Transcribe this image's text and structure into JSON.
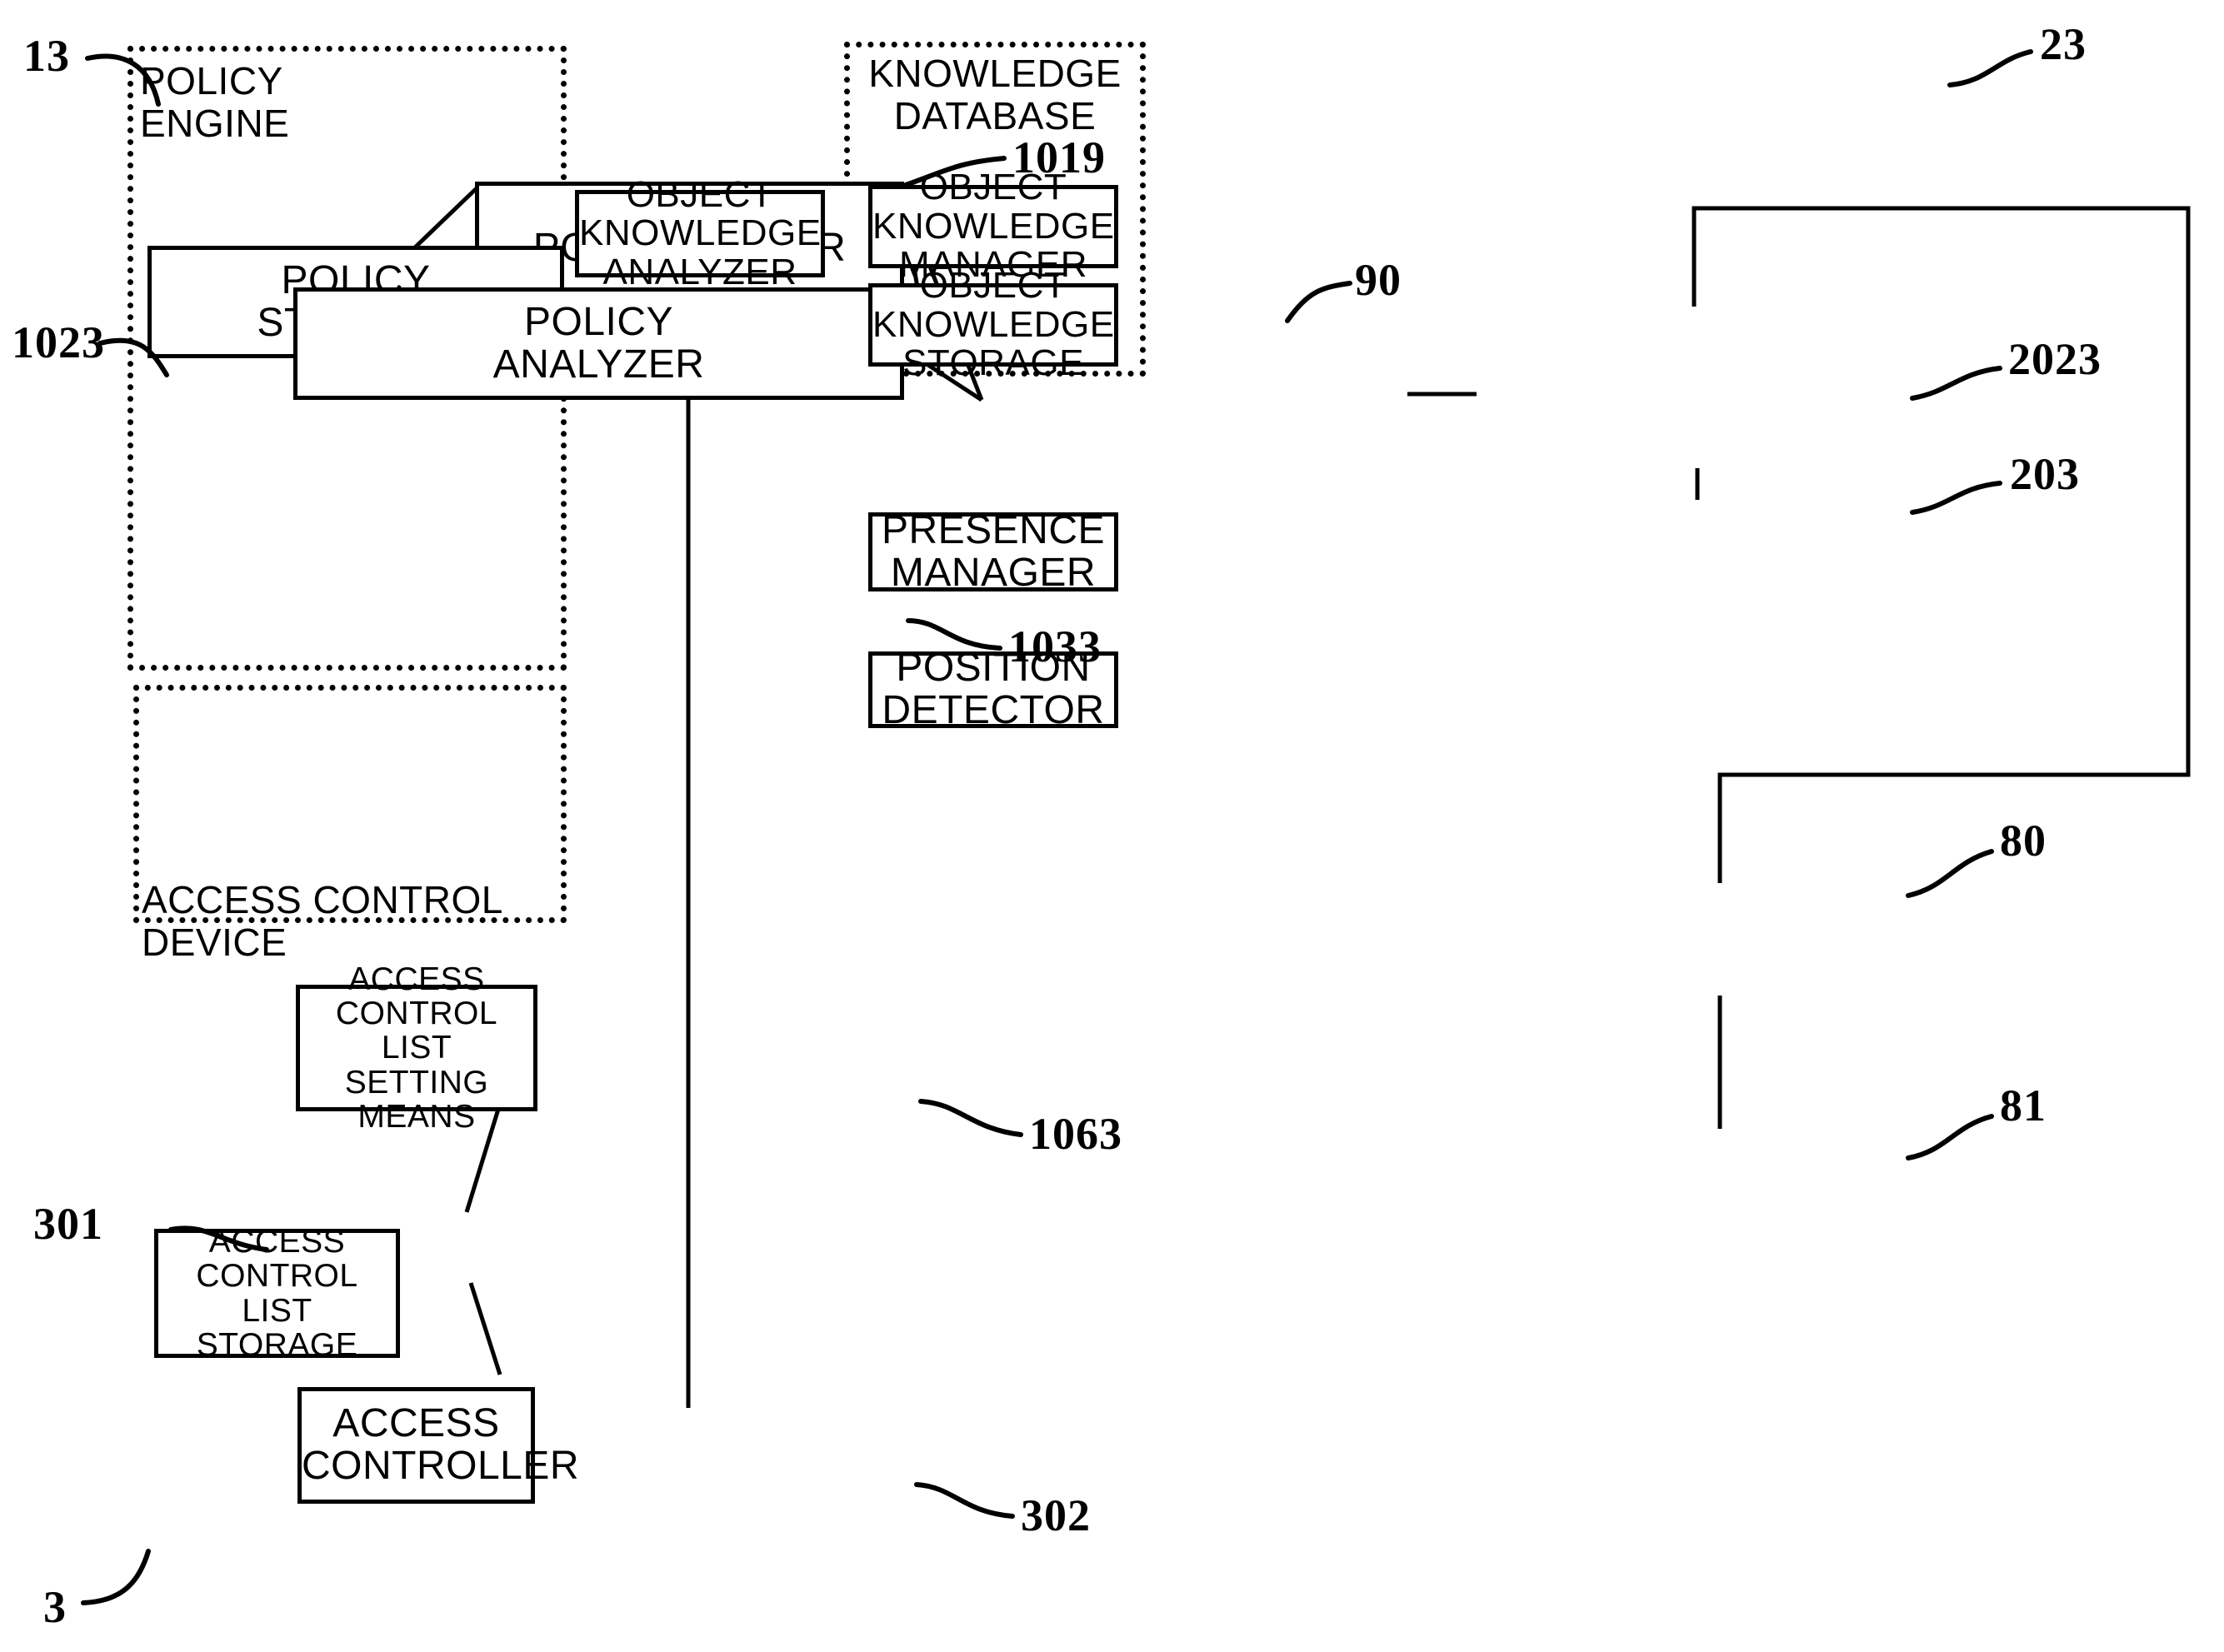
{
  "figure": {
    "kind": "patent-block-diagram",
    "background_color": "#ffffff",
    "line_color": "#000000"
  },
  "groups": [
    {
      "id": "policy-engine",
      "title": "POLICY ENGINE",
      "ref": "13"
    },
    {
      "id": "access-control-device",
      "title": "ACCESS CONTROL DEVICE",
      "ref": "3"
    },
    {
      "id": "knowledge-database",
      "title": "KNOWLEDGE\nDATABASE",
      "ref": "23"
    }
  ],
  "blocks": [
    {
      "id": "policy-editor",
      "label": "POLICY EDITOR",
      "ref": "1019"
    },
    {
      "id": "policy-storage",
      "label": "POLICY\nSTORAGE",
      "ref": "1023"
    },
    {
      "id": "policy-analyzer",
      "label": "POLICY\nANALYZER",
      "ref": "1033"
    },
    {
      "id": "acl-setting-means",
      "label": "ACCESS\nCONTROL LIST\nSETTING MEANS",
      "ref": "1063"
    },
    {
      "id": "acl-storage",
      "label": "ACCESS\nCONTROL LIST\nSTORAGE",
      "ref": "301"
    },
    {
      "id": "access-controller",
      "label": "ACCESS\nCONTROLLER",
      "ref": "302"
    },
    {
      "id": "object-knowledge-analyzer",
      "label": "OBJECT\nKNOWLEDGE\nANALYZER",
      "ref": "90"
    },
    {
      "id": "object-knowledge-manager",
      "label": "OBJECT\nKNOWLEDGE\nMANAGER",
      "ref": "2023"
    },
    {
      "id": "object-knowledge-storage",
      "label": "OBJECT\nKNOWLEDGE\nSTORAGE",
      "ref": "203"
    },
    {
      "id": "presence-manager",
      "label": "PRESENCE\nMANAGER",
      "ref": "80"
    },
    {
      "id": "position-detector",
      "label": "POSITION\nDETECTOR",
      "ref": "81"
    }
  ],
  "refs": {
    "policy_engine": "13",
    "policy_editor": "1019",
    "policy_storage": "1023",
    "policy_analyzer": "1033",
    "acl_setting_means": "1063",
    "acl_storage": "301",
    "access_controller": "302",
    "access_control_device": "3",
    "object_knowledge_analyzer": "90",
    "knowledge_database": "23",
    "object_knowledge_manager": "2023",
    "object_knowledge_storage": "203",
    "presence_manager": "80",
    "position_detector": "81"
  },
  "labels": {
    "policy_engine": "POLICY ENGINE",
    "access_control_device": "ACCESS CONTROL DEVICE",
    "knowledge_database": "KNOWLEDGE\nDATABASE",
    "policy_editor": "POLICY EDITOR",
    "policy_storage": "POLICY\nSTORAGE",
    "policy_analyzer": "POLICY\nANALYZER",
    "acl_setting_means": "ACCESS\nCONTROL LIST\nSETTING MEANS",
    "acl_storage": "ACCESS\nCONTROL LIST\nSTORAGE",
    "access_controller": "ACCESS\nCONTROLLER",
    "object_knowledge_analyzer": "OBJECT\nKNOWLEDGE\nANALYZER",
    "object_knowledge_manager": "OBJECT\nKNOWLEDGE\nMANAGER",
    "object_knowledge_storage": "OBJECT\nKNOWLEDGE\nSTORAGE",
    "presence_manager": "PRESENCE\nMANAGER",
    "position_detector": "POSITION\nDETECTOR"
  },
  "connections": [
    {
      "from": "policy-editor",
      "to": "policy-storage"
    },
    {
      "from": "policy-editor",
      "to": "policy-analyzer"
    },
    {
      "from": "policy-editor",
      "to": "object-knowledge-analyzer"
    },
    {
      "from": "policy-storage",
      "to": "policy-analyzer"
    },
    {
      "from": "policy-analyzer",
      "to": "object-knowledge-analyzer"
    },
    {
      "from": "policy-editor",
      "to": "acl-setting-means"
    },
    {
      "from": "acl-setting-means",
      "to": "acl-storage"
    },
    {
      "from": "acl-setting-means",
      "to": "access-controller"
    },
    {
      "from": "acl-storage",
      "to": "access-controller"
    },
    {
      "from": "object-knowledge-analyzer",
      "to": "object-knowledge-manager"
    },
    {
      "from": "object-knowledge-manager",
      "to": "object-knowledge-storage"
    },
    {
      "from": "object-knowledge-manager",
      "to": "presence-manager"
    },
    {
      "from": "presence-manager",
      "to": "position-detector"
    }
  ]
}
